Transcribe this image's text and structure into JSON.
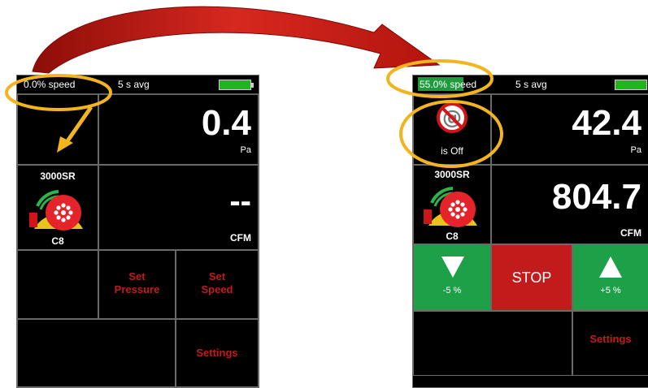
{
  "left_device": {
    "speed_text": "0.0% speed",
    "avg_text": "5 s avg",
    "pressure_value": "0.4",
    "pressure_unit": "Pa",
    "fan_model": "3000SR",
    "fan_ring": "C8",
    "flow_value": "--",
    "flow_unit": "CFM",
    "set_pressure_label_1": "Set",
    "set_pressure_label_2": "Pressure",
    "set_speed_label_1": "Set",
    "set_speed_label_2": "Speed",
    "settings_label": "Settings"
  },
  "right_device": {
    "speed_text": "55.0% speed",
    "avg_text": "5 s avg",
    "baseline_status": "is Off",
    "pressure_value": "42.4",
    "pressure_unit": "Pa",
    "fan_model": "3000SR",
    "fan_ring": "C8",
    "flow_value": "804.7",
    "flow_unit": "CFM",
    "minus_label": "-5 %",
    "stop_label": "STOP",
    "plus_label": "+5 %",
    "settings_label": "Settings"
  },
  "colors": {
    "highlight_circle": "#f2b51f",
    "arrow": "#c0150f",
    "green_button": "#1ea048",
    "stop_button": "#c31b1b",
    "battery": "#1fb51f"
  }
}
